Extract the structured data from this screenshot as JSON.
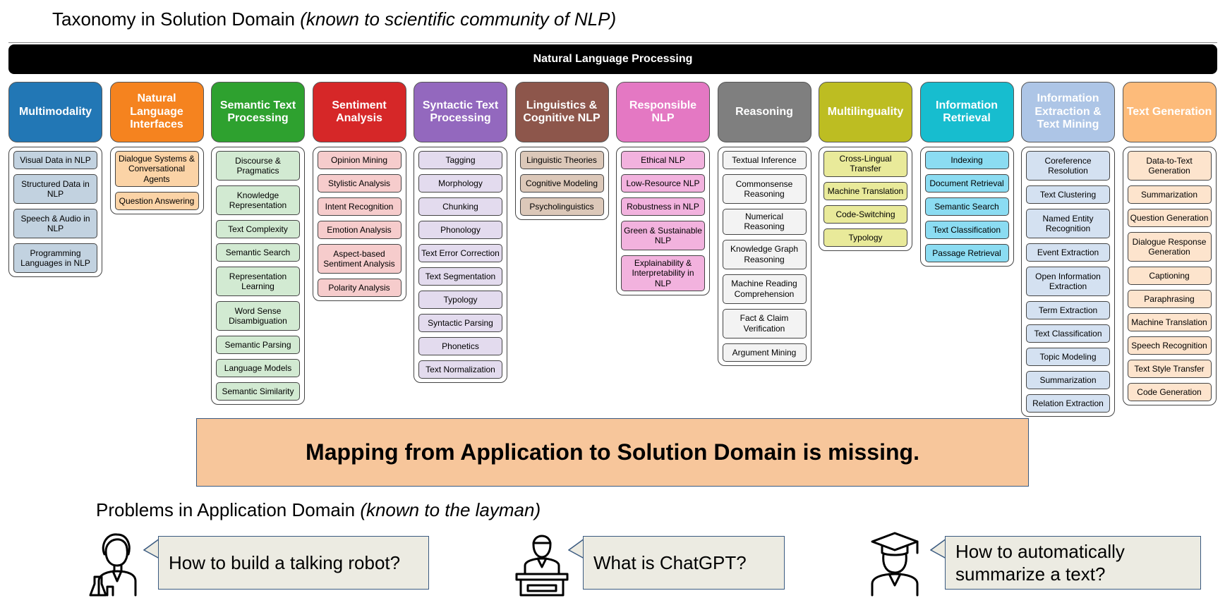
{
  "top_heading": {
    "main": "Taxonomy in Solution Domain",
    "note": "(known to scientific community of NLP)"
  },
  "nlp_bar": "Natural Language Processing",
  "categories": [
    {
      "label": "Multimodality",
      "color": "#2277b5",
      "sub_color": "#c2d2e0",
      "items": [
        "Visual Data in NLP",
        "Structured Data in NLP",
        "Speech & Audio in NLP",
        "Programming Languages in NLP"
      ]
    },
    {
      "label": "Natural Language Interfaces",
      "color": "#f5831f",
      "sub_color": "#fbd3a6",
      "items": [
        "Dialogue Systems & Conversational Agents",
        "Question Answering"
      ]
    },
    {
      "label": "Semantic Text Processing",
      "color": "#2ea12f",
      "sub_color": "#d2ead2",
      "items": [
        "Discourse & Pragmatics",
        "Knowledge Representation",
        "Text Complexity",
        "Semantic Search",
        "Representation Learning",
        "Word Sense Disambiguation",
        "Semantic Parsing",
        "Language Models",
        "Semantic Similarity"
      ]
    },
    {
      "label": "Sentiment Analysis",
      "color": "#d62728",
      "sub_color": "#f6cccc",
      "items": [
        "Opinion Mining",
        "Stylistic Analysis",
        "Intent Recognition",
        "Emotion Analysis",
        "Aspect-based Sentiment Analysis",
        "Polarity Analysis"
      ]
    },
    {
      "label": "Syntactic Text Processing",
      "color": "#9368be",
      "sub_color": "#e3dbee",
      "items": [
        "Tagging",
        "Morphology",
        "Chunking",
        "Phonology",
        "Text Error Correction",
        "Text Segmentation",
        "Typology",
        "Syntactic Parsing",
        "Phonetics",
        "Text Normalization"
      ]
    },
    {
      "label": "Linguistics & Cognitive NLP",
      "color": "#8d564b",
      "sub_color": "#dcc8b9",
      "items": [
        "Linguistic Theories",
        "Cognitive Modeling",
        "Psycholinguistics"
      ]
    },
    {
      "label": "Responsible NLP",
      "color": "#e478c3",
      "sub_color": "#f2b2de",
      "items": [
        "Ethical NLP",
        "Low-Resource NLP",
        "Robustness in NLP",
        "Green & Sustainable NLP",
        "Explainability & Interpretability in NLP"
      ]
    },
    {
      "label": "Reasoning",
      "color": "#7f7f7f",
      "sub_color": "#f3f3f3",
      "items": [
        "Textual Inference",
        "Commonsense Reasoning",
        "Numerical Reasoning",
        "Knowledge Graph Reasoning",
        "Machine Reading Comprehension",
        "Fact & Claim Verification",
        "Argument Mining"
      ]
    },
    {
      "label": "Multilinguality",
      "color": "#bdbd22",
      "sub_color": "#e9ea9a",
      "items": [
        "Cross-Lingual Transfer",
        "Machine Translation",
        "Code-Switching",
        "Typology"
      ]
    },
    {
      "label": "Information Retrieval",
      "color": "#17bdcf",
      "sub_color": "#8bdcf2",
      "items": [
        "Indexing",
        "Document Retrieval",
        "Semantic Search",
        "Text Classification",
        "Passage Retrieval"
      ]
    },
    {
      "label": "Information Extraction & Text Mining",
      "color": "#adc5e6",
      "sub_color": "#d4e1f1",
      "items": [
        "Coreference Resolution",
        "Text Clustering",
        "Named Entity Recognition",
        "Event Extraction",
        "Open Information Extraction",
        "Term Extraction",
        "Text Classification",
        "Topic Modeling",
        "Summarization",
        "Relation Extraction"
      ]
    },
    {
      "label": "Text Generation",
      "color": "#fdbb7a",
      "sub_color": "#fde4cd",
      "items": [
        "Data-to-Text Generation",
        "Summarization",
        "Question Generation",
        "Dialogue Response Generation",
        "Captioning",
        "Paraphrasing",
        "Machine Translation",
        "Speech Recognition",
        "Text Style Transfer",
        "Code Generation"
      ]
    }
  ],
  "tall_items": [
    "Structured Data in NLP",
    "Speech & Audio in NLP",
    "Programming Languages in NLP",
    "Dialogue Systems & Conversational Agents",
    "Discourse & Pragmatics",
    "Knowledge Representation",
    "Representation Learning",
    "Word Sense Disambiguation",
    "Aspect-based Sentiment Analysis",
    "Green & Sustainable NLP",
    "Explainability & Interpretability in NLP",
    "Commonsense Reasoning",
    "Knowledge Graph Reasoning",
    "Machine Reading Comprehension",
    "Fact & Claim Verification",
    "Coreference Resolution",
    "Named Entity Recognition",
    "Open Information Extraction",
    "Data-to-Text Generation",
    "Dialogue Response Generation"
  ],
  "missing_banner": "Mapping from Application to Solution Domain is missing.",
  "bottom_heading": {
    "main": "Problems in Application Domain",
    "note": "(known to the layman)"
  },
  "problems": [
    {
      "icon": "scientist-icon",
      "question": "How to build a talking robot?"
    },
    {
      "icon": "desk-worker-icon",
      "question": "What is ChatGPT?"
    },
    {
      "icon": "graduate-icon",
      "question": "How to automatically summarize a text?"
    }
  ]
}
